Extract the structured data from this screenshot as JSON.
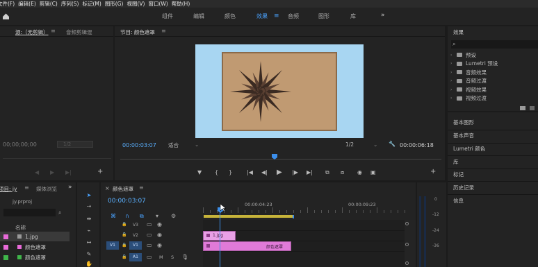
{
  "menu": [
    "文件(F)",
    "编辑(E)",
    "剪辑(C)",
    "序列(S)",
    "标记(M)",
    "图形(G)",
    "视图(V)",
    "窗口(W)",
    "帮助(H)"
  ],
  "workspaces": [
    "组件",
    "编辑",
    "颜色",
    "效果",
    "音频",
    "图形",
    "库"
  ],
  "source_panel": {
    "tab1": "源:（无剪辑）",
    "tab2": "音频剪辑混",
    "timecode": "00;00;00;00",
    "page": "1/2"
  },
  "program": {
    "title": "节目: 颜色遮罩",
    "timecode": "00:00:03:07",
    "fit": "适合",
    "resolution": "1/2",
    "duration": "00:00:06:18",
    "preview_bg": "#a8d6f2"
  },
  "effects": {
    "title": "效果",
    "items": [
      "预设",
      "Lumetri 预设",
      "音频效果",
      "音频过渡",
      "视频效果",
      "视频过渡"
    ]
  },
  "side_panels": [
    "基本图形",
    "基本声音",
    "Lumetri 颜色",
    "库",
    "标记",
    "历史记录",
    "信息"
  ],
  "project": {
    "tab1": "项目: jy",
    "tab2": "媒体浏览",
    "file": "jy.prproj",
    "column_name": "名称",
    "items": [
      {
        "name": "1.jpg",
        "color": "#e86ad9"
      },
      {
        "name": "颜色遮罩",
        "color": "#e86ad9"
      },
      {
        "name": "颜色遮罩",
        "color": "#3fb54a"
      }
    ]
  },
  "timeline": {
    "title": "颜色遮罩",
    "timecode": "00:00:03:07",
    "ruler_labels": [
      "00:00:04:23",
      "00:00:09:23"
    ],
    "tracks": [
      {
        "name": "V3"
      },
      {
        "name": "V2"
      },
      {
        "name": "V1",
        "src": "V1"
      },
      {
        "name": "A1"
      }
    ],
    "clips": [
      {
        "label": "1.jpg",
        "color": "#e9a0e6"
      },
      {
        "label": "颜色遮罩",
        "color": "#e07ad8"
      }
    ],
    "audio_btns": [
      "M",
      "S"
    ]
  },
  "meter": [
    "0",
    "-12",
    "-24",
    "-36"
  ]
}
